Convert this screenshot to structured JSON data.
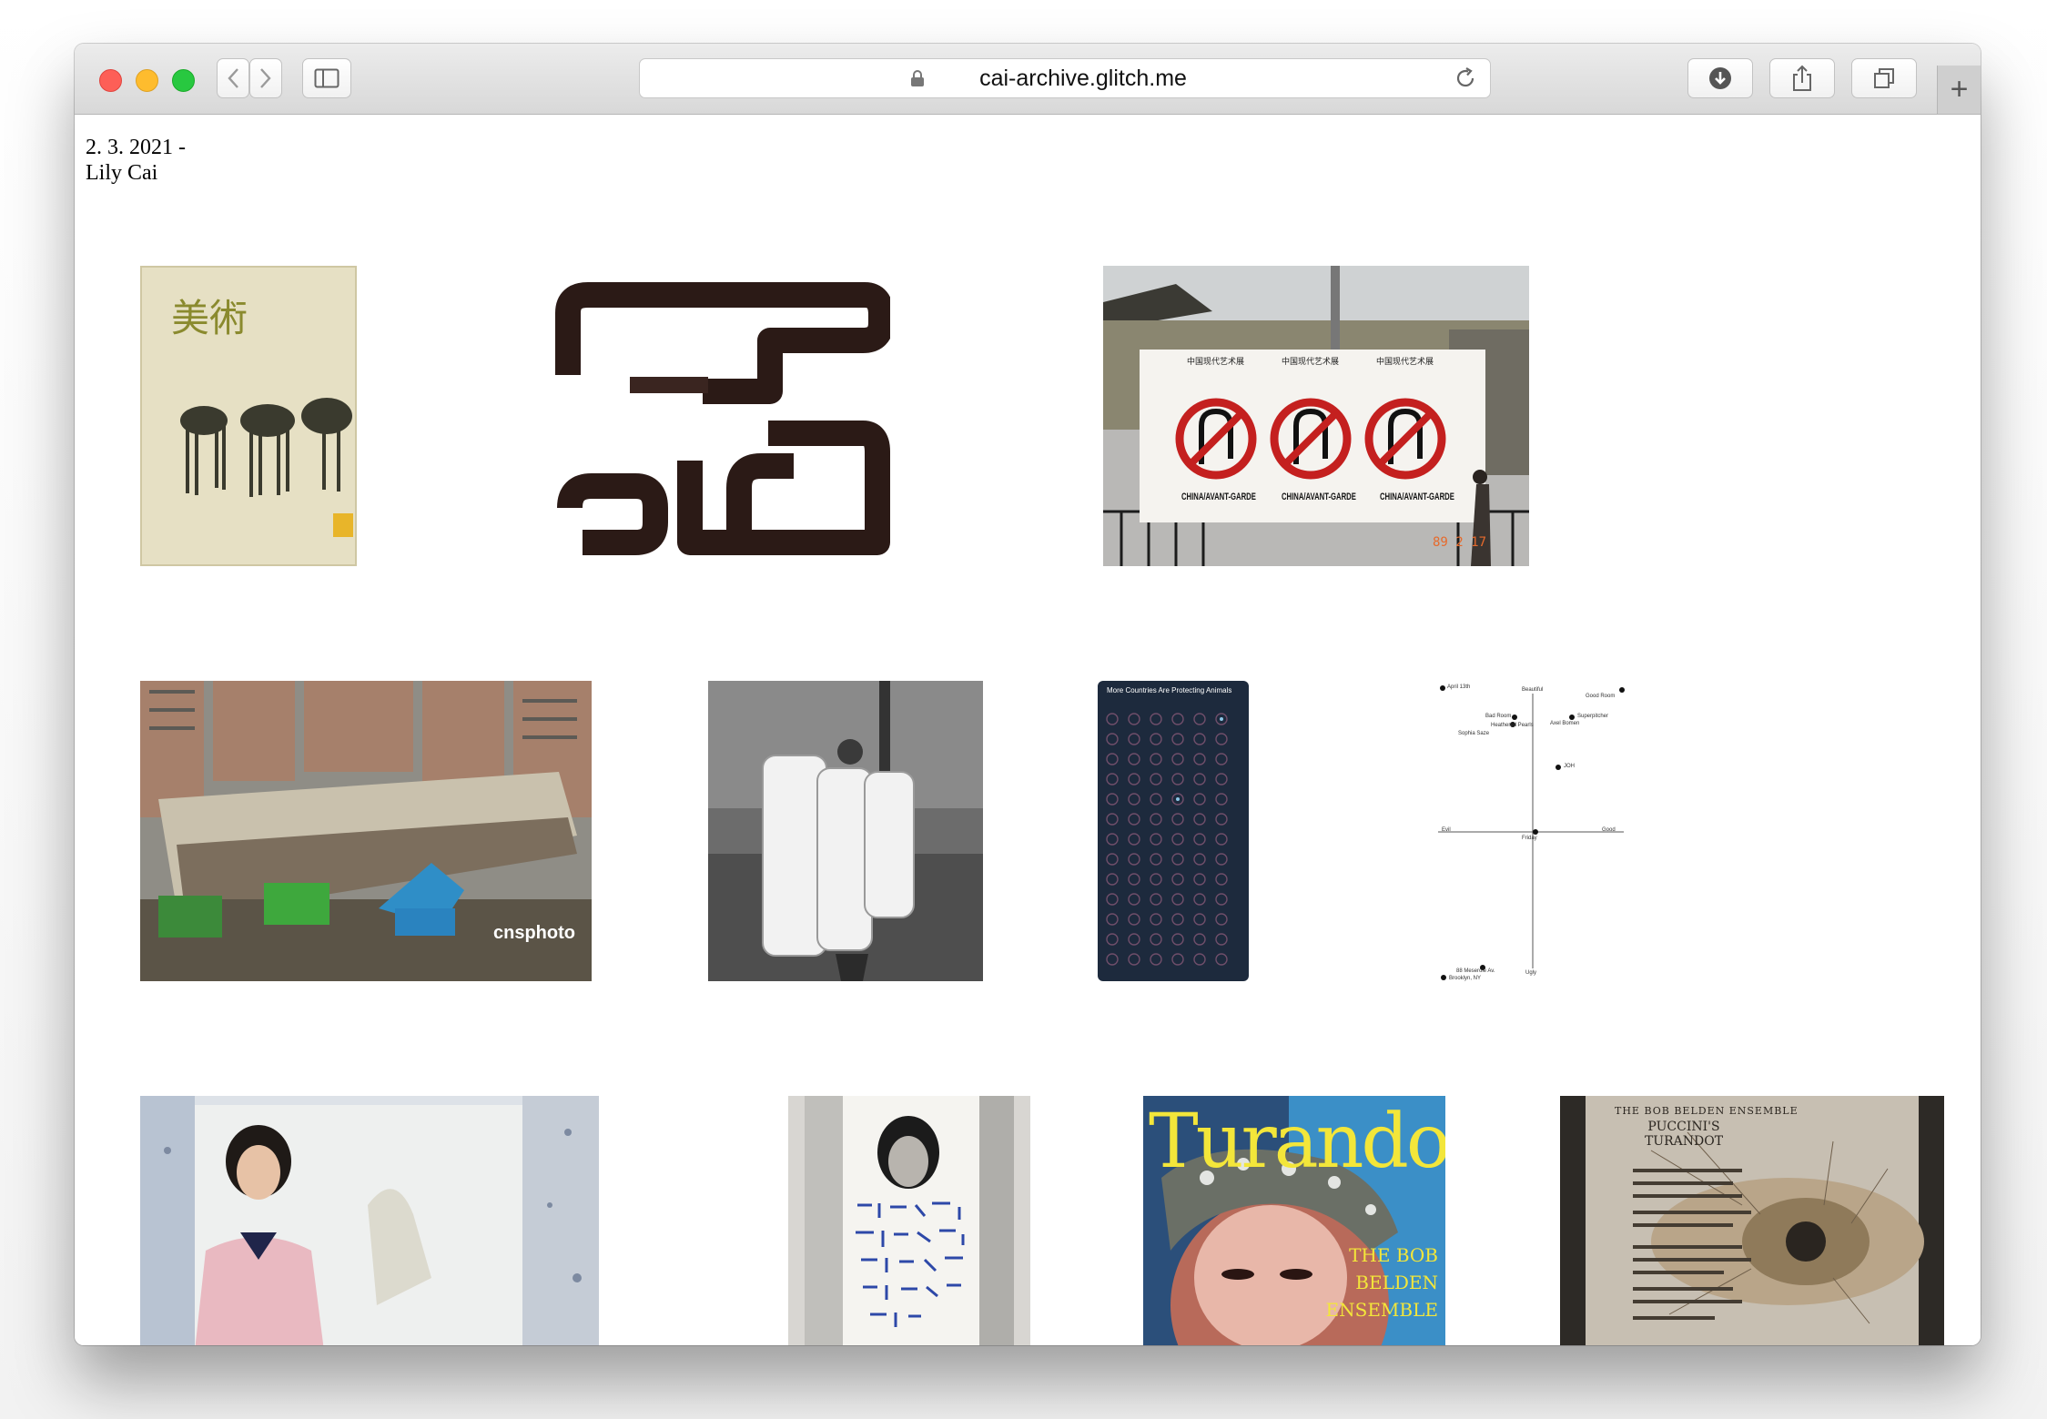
{
  "browser": {
    "url": "cai-archive.glitch.me",
    "new_tab_symbol": "+"
  },
  "page": {
    "date": "2. 3. 2021 -",
    "author": "Lily Cai"
  },
  "images": {
    "magazine": {
      "title": "美術"
    },
    "exhibition": {
      "banner": "CHINA/AVANT-GARDE",
      "date_stamp": "89 2 17"
    },
    "demolition": {
      "watermark": "cnsphoto"
    },
    "infographic": {
      "title": "More Countries Are Protecting Animals"
    },
    "mood_chart": {
      "axis_top": "Beautiful",
      "axis_bottom": "Ugly",
      "axis_left": "Evil",
      "axis_right": "Good",
      "points": [
        "April 13th",
        "Good Room",
        "Superpitcher",
        "Axel Bomen",
        "Bad Room",
        "Heathered Pearls",
        "Sophia Saze",
        "JOH",
        "Friday",
        "88 Meserole Av.",
        "Brooklyn, NY"
      ]
    },
    "turandot": {
      "title": "Turandot",
      "artist": "THE BOB BELDEN ENSEMBLE"
    },
    "turandot_back": {
      "ensemble": "THE BOB BELDEN ENSEMBLE",
      "title": "PUCCINI'S TURANDOT"
    }
  }
}
